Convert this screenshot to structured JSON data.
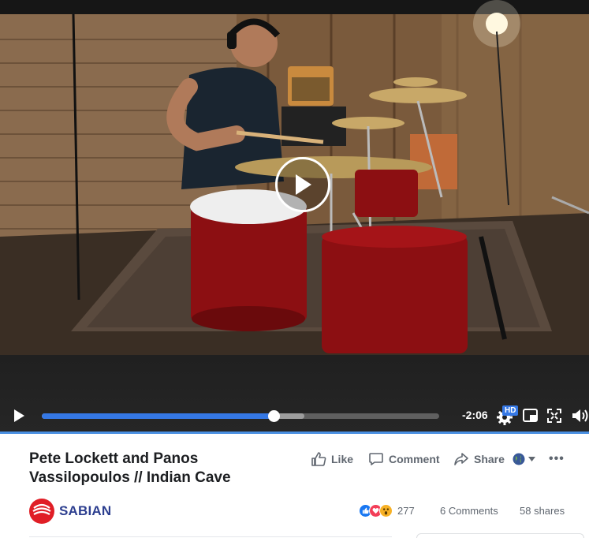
{
  "video": {
    "time_remaining": "-2:06",
    "quality_badge": "HD",
    "progress_fraction": 0.584,
    "buffered_fraction": 0.66
  },
  "post": {
    "title_line1": "Pete Lockett and Panos",
    "title_line2": "Vassilopoulos // Indian Cave",
    "actions": {
      "like": "Like",
      "comment": "Comment",
      "share": "Share"
    },
    "more": "•••"
  },
  "page": {
    "name": "SABIAN"
  },
  "stats": {
    "reactions_count": "277",
    "comments": "6 Comments",
    "shares": "58 shares"
  },
  "icons": {
    "play": "play-icon",
    "settings": "gear-icon",
    "pip": "picture-in-picture-icon",
    "fullscreen": "fullscreen-icon",
    "volume": "volume-icon",
    "like": "thumbs-up-icon",
    "comment": "speech-bubble-icon",
    "share": "share-arrow-icon",
    "audience": "globe-icon"
  },
  "colors": {
    "progress": "#3578e5",
    "brand_red": "#e01e26",
    "brand_blue": "#2c3e8f"
  }
}
